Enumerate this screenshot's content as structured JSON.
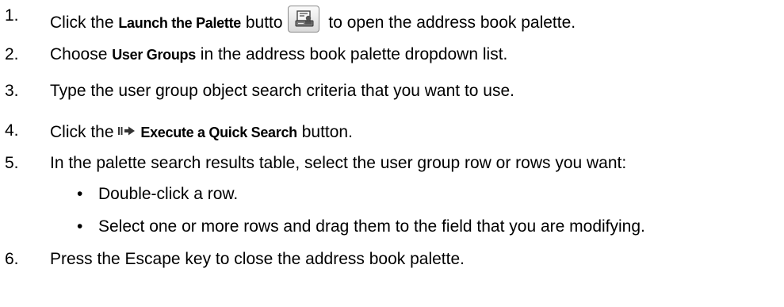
{
  "steps": [
    {
      "num": "1.",
      "pre": "Click the ",
      "term": "Launch the Palette",
      "mid": " butto",
      "post": " to open the address book palette.",
      "icon": "launch-palette-icon"
    },
    {
      "num": "2.",
      "pre": "Choose ",
      "term": "User Groups",
      "post": " in the address book palette dropdown list."
    },
    {
      "num": "3.",
      "text": "Type the user group object search criteria that you want to use."
    },
    {
      "num": "4.",
      "pre": "Click the ",
      "term": "Execute a Quick Search",
      "post": " button.",
      "icon": "execute-quick-search-icon"
    },
    {
      "num": "5.",
      "text": "In the palette search results table, select the user group row or rows you want:"
    },
    {
      "num": "6.",
      "text": "Press the Escape key to close the address book palette."
    }
  ],
  "bullets": [
    {
      "symbol": "•",
      "text": "Double-click a row."
    },
    {
      "symbol": "•",
      "text": "Select one or more rows and drag them to the field that you are modifying."
    }
  ]
}
